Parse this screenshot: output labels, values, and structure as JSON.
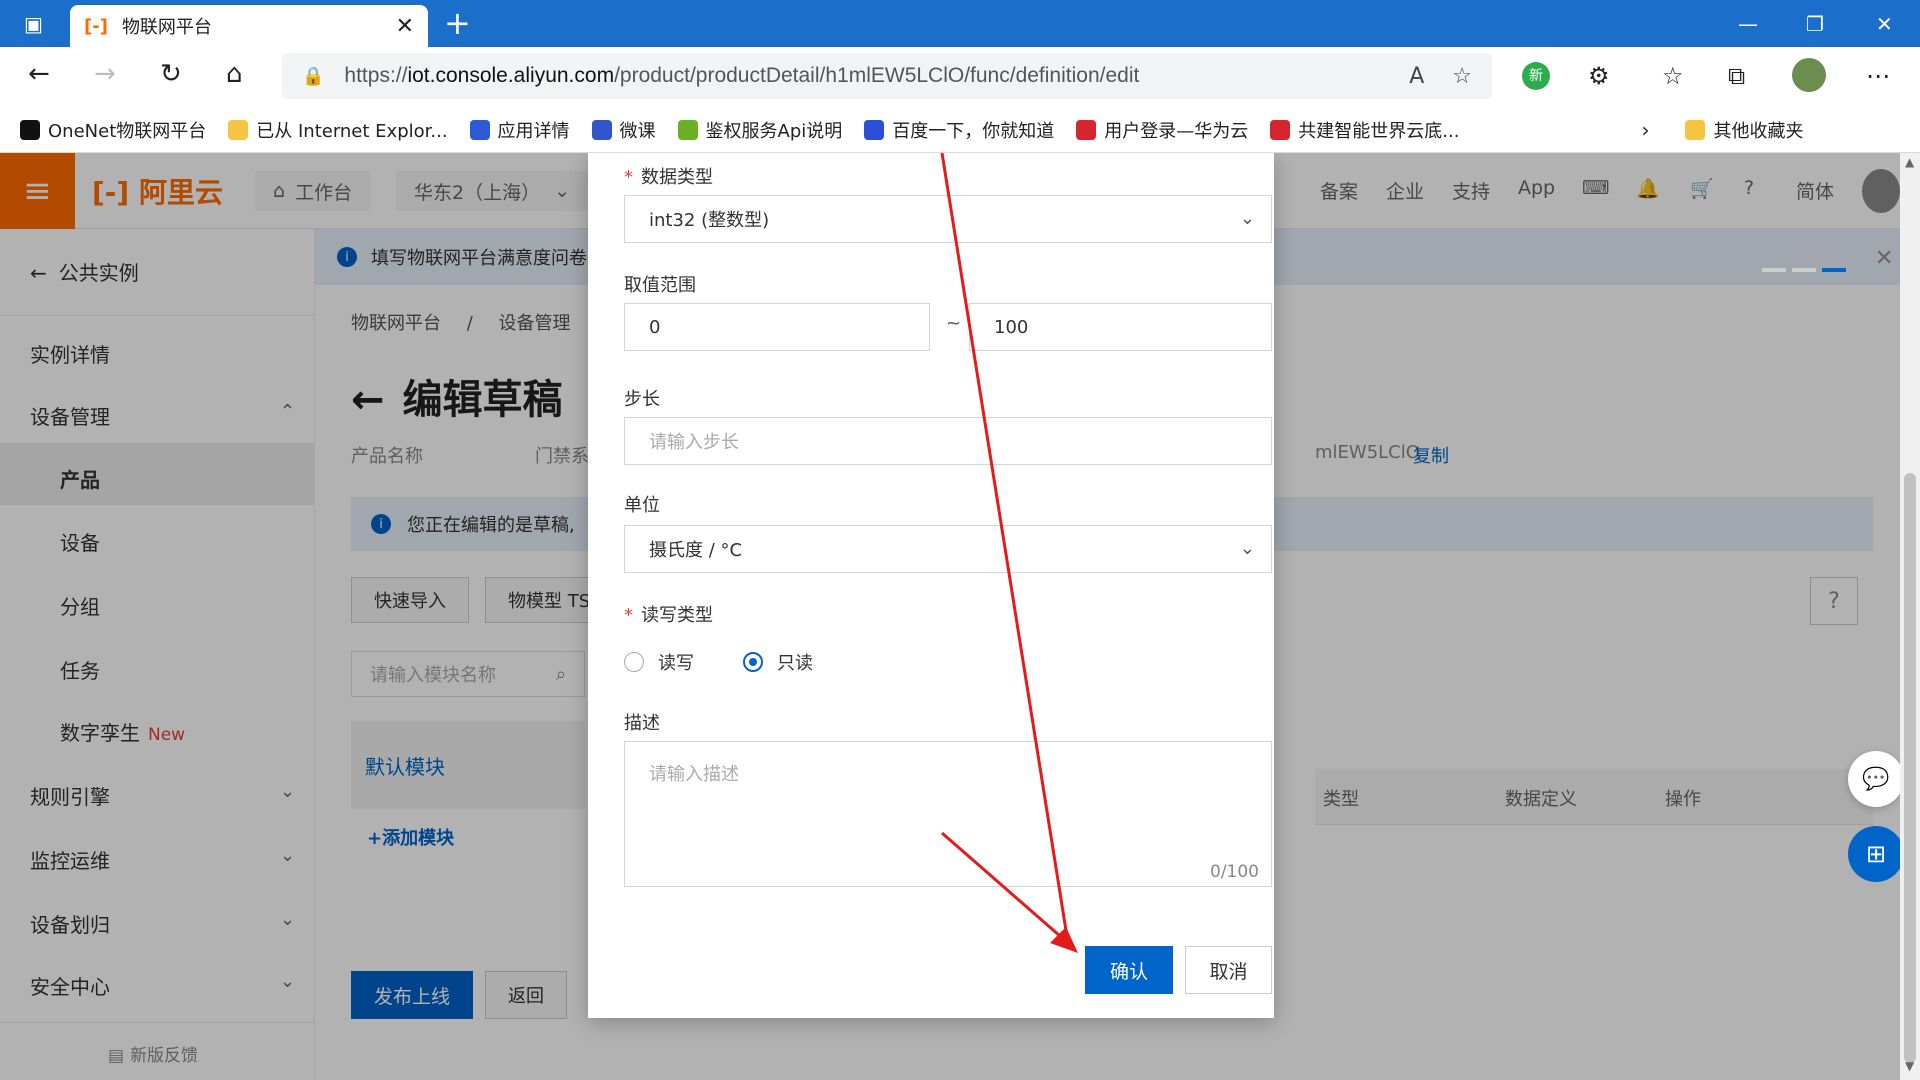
{
  "browser": {
    "tab_title": "物联网平台",
    "url_prefix": "https://",
    "url_host": "iot.console.aliyun.com",
    "url_path": "/product/productDetail/h1mlEW5LClO/func/definition/edit",
    "bookmarks": [
      {
        "label": "OneNet物联网平台",
        "color": "#111111"
      },
      {
        "label": "已从 Internet Explor...",
        "color": "#f5c542"
      },
      {
        "label": "应用详情",
        "color": "#2d5bd8"
      },
      {
        "label": "微课",
        "color": "#3355cc"
      },
      {
        "label": "鉴权服务Api说明",
        "color": "#6ab023"
      },
      {
        "label": "百度一下，你就知道",
        "color": "#2b50d6"
      },
      {
        "label": "用户登录—华为云",
        "color": "#d8242d"
      },
      {
        "label": "共建智能世界云底...",
        "color": "#d8242d"
      }
    ],
    "other_bookmarks": "其他收藏夹",
    "ext_badge": "新"
  },
  "topnav": {
    "logo": "阿里云",
    "workbench": "工作台",
    "region": "华东2（上海）",
    "right_items": [
      "备案",
      "企业",
      "支持",
      "App",
      "简体"
    ]
  },
  "sidebar": {
    "back": "公共实例",
    "items": [
      {
        "label": "实例详情"
      },
      {
        "label": "设备管理"
      },
      {
        "label": "产品"
      },
      {
        "label": "设备"
      },
      {
        "label": "分组"
      },
      {
        "label": "任务"
      },
      {
        "label": "数字孪生",
        "tag": "New"
      },
      {
        "label": "规则引擎"
      },
      {
        "label": "监控运维"
      },
      {
        "label": "设备划归"
      },
      {
        "label": "安全中心"
      }
    ],
    "feedback": "新版反馈"
  },
  "content": {
    "banner": "填写物联网平台满意度问卷",
    "breadcrumb": [
      "物联网平台",
      "/",
      "设备管理",
      "/"
    ],
    "title": "编辑草稿",
    "product_name_label": "产品名称",
    "product_name_value": "门禁系",
    "product_key_tail": "mlEW5LClO",
    "copy": "复制",
    "draft_notice": "您正在编辑的是草稿,",
    "quick_import": "快速导入",
    "tsl": "物模型 TS",
    "search_placeholder": "请输入模块名称",
    "default_module": "默认模块",
    "add_module": "+添加模块",
    "table_headers": [
      "类型",
      "数据定义",
      "操作"
    ],
    "publish": "发布上线",
    "back": "返回"
  },
  "modal": {
    "data_type_label": "数据类型",
    "data_type_value": "int32 (整数型)",
    "range_label": "取值范围",
    "range_min": "0",
    "range_sep": "~",
    "range_max": "100",
    "step_label": "步长",
    "step_placeholder": "请输入步长",
    "unit_label": "单位",
    "unit_value": "摄氏度 / °C",
    "rw_label": "读写类型",
    "rw_options": [
      "读写",
      "只读"
    ],
    "rw_selected": "只读",
    "desc_label": "描述",
    "desc_placeholder": "请输入描述",
    "desc_count": "0/100",
    "confirm": "确认",
    "cancel": "取消"
  },
  "colors": {
    "primary": "#0064c8",
    "brand": "#ff6a00",
    "annotation_arrow": "#e31b1b"
  }
}
